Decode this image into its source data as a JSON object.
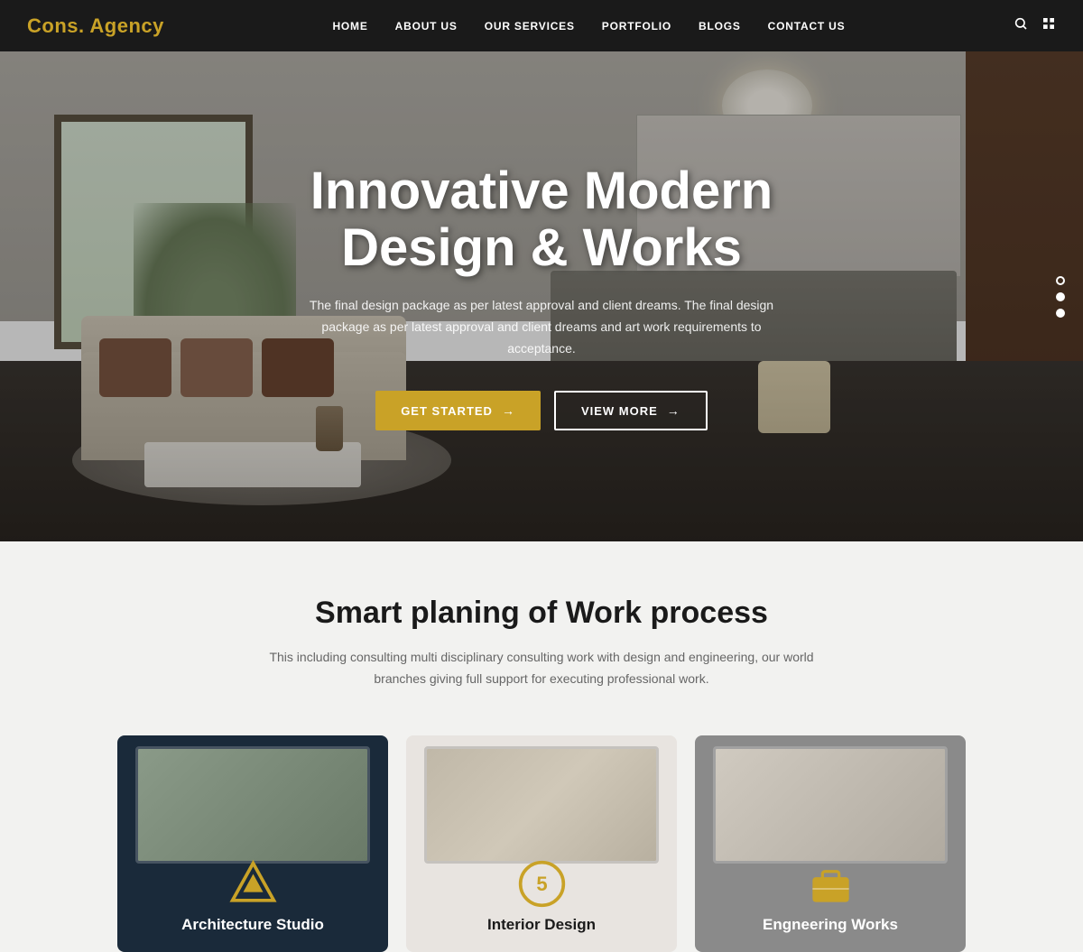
{
  "brand": {
    "name": "Cons. Agency"
  },
  "nav": {
    "links": [
      {
        "id": "home",
        "label": "HOME"
      },
      {
        "id": "about",
        "label": "ABOUT US"
      },
      {
        "id": "services",
        "label": "OUR SERVICES"
      },
      {
        "id": "portfolio",
        "label": "PORTFOLIO"
      },
      {
        "id": "blogs",
        "label": "BLOGS"
      },
      {
        "id": "contact",
        "label": "CONTACT US"
      }
    ],
    "search_icon": "🔍",
    "grid_icon": "⊞"
  },
  "hero": {
    "title_line1": "Innovative Modern",
    "title_line2": "Design & Works",
    "subtitle": "The final design package as per latest approval and client dreams. The final design package as per latest approval and client dreams and art work requirements to acceptance.",
    "btn_primary": "GET STARTED",
    "btn_secondary": "VIEW MORE"
  },
  "section2": {
    "title": "Smart planing of Work process",
    "description": "This including consulting multi disciplinary consulting work with design and engineering, our world branches giving full support for executing professional work.",
    "cards": [
      {
        "id": "architecture",
        "label": "Architecture Studio",
        "icon": "▲",
        "theme": "navy"
      },
      {
        "id": "interior",
        "label": "Interior Design",
        "icon": "⑤",
        "theme": "light"
      },
      {
        "id": "engineering",
        "label": "Engneering Works",
        "icon": "💼",
        "theme": "grey"
      }
    ]
  },
  "colors": {
    "accent": "#c9a227",
    "navy": "#1a2a3a",
    "dark": "#1a1a1a"
  }
}
